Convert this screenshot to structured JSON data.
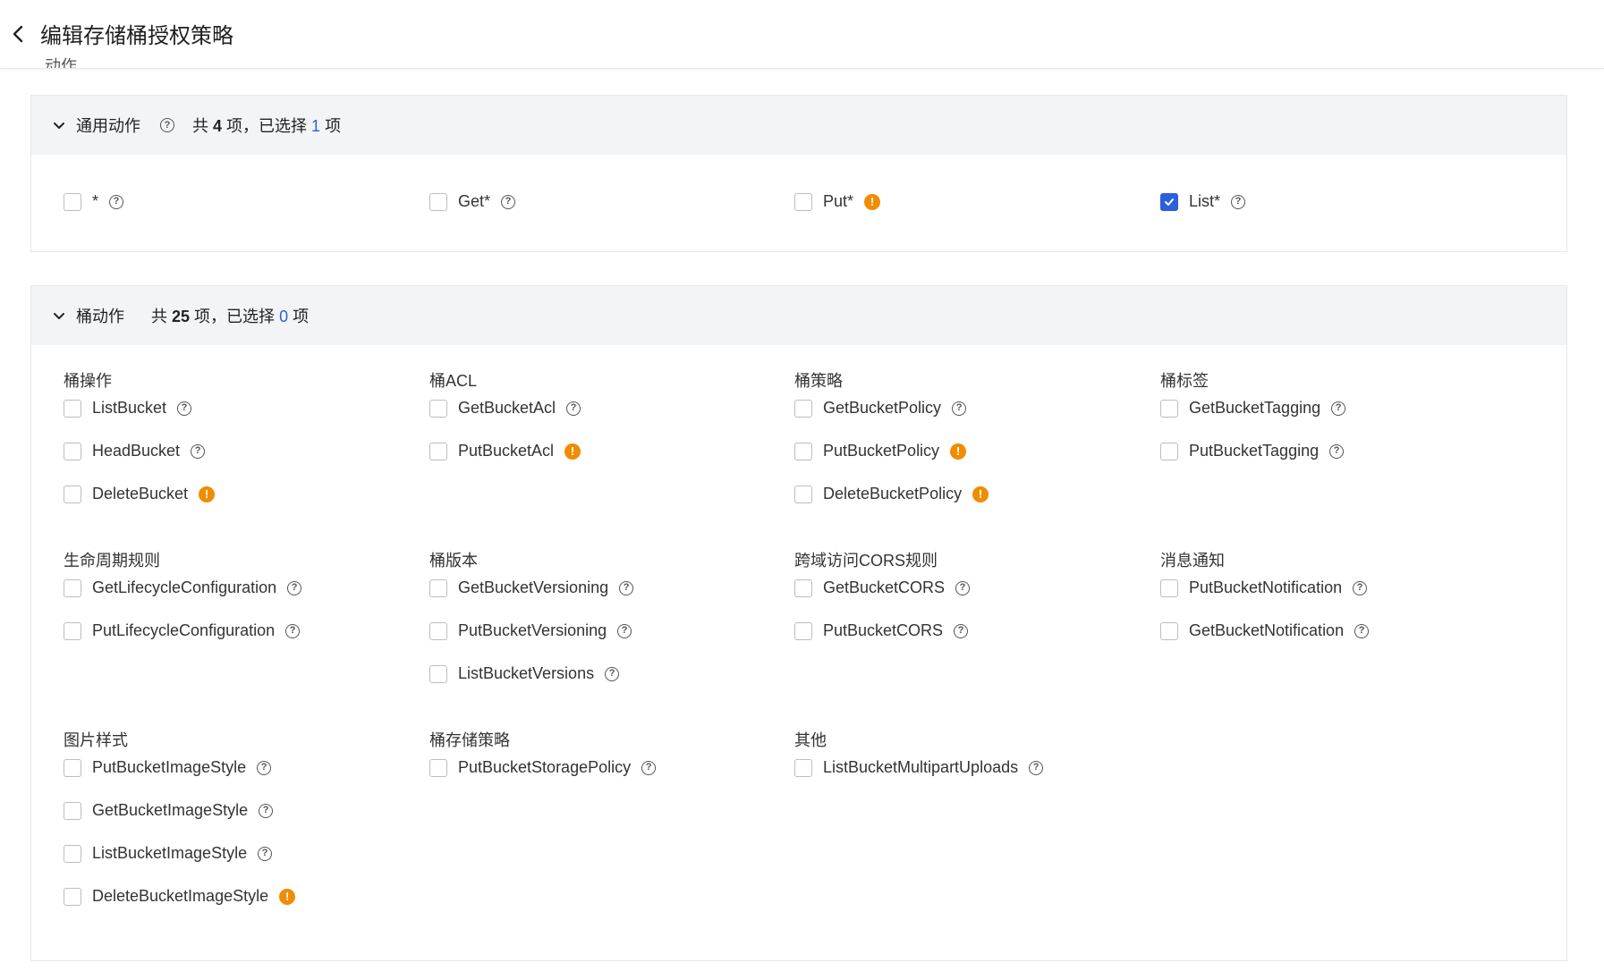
{
  "header": {
    "title": "编辑存储桶授权策略"
  },
  "peek_label": "动作",
  "general": {
    "name": "通用动作",
    "count_prefix": "共 ",
    "count_total": "4",
    "count_mid": " 项，已选择 ",
    "count_selected": "1",
    "count_suffix": " 项",
    "items": [
      {
        "label": "*",
        "checked": false,
        "icon": "help-icon"
      },
      {
        "label": "Get*",
        "checked": false,
        "icon": "help-icon"
      },
      {
        "label": "Put*",
        "checked": false,
        "icon": "warning-icon"
      },
      {
        "label": "List*",
        "checked": true,
        "icon": "help-icon"
      }
    ]
  },
  "bucket": {
    "name": "桶动作",
    "count_prefix": "共 ",
    "count_total": "25",
    "count_mid": " 项，已选择 ",
    "count_selected": "0",
    "count_suffix": " 项",
    "groups": [
      {
        "title": "桶操作",
        "items": [
          {
            "label": "ListBucket",
            "icon": "help-icon"
          },
          {
            "label": "HeadBucket",
            "icon": "help-icon"
          },
          {
            "label": "DeleteBucket",
            "icon": "warning-icon"
          }
        ]
      },
      {
        "title": "桶ACL",
        "items": [
          {
            "label": "GetBucketAcl",
            "icon": "help-icon"
          },
          {
            "label": "PutBucketAcl",
            "icon": "warning-icon"
          }
        ]
      },
      {
        "title": "桶策略",
        "items": [
          {
            "label": "GetBucketPolicy",
            "icon": "help-icon"
          },
          {
            "label": "PutBucketPolicy",
            "icon": "warning-icon"
          },
          {
            "label": "DeleteBucketPolicy",
            "icon": "warning-icon"
          }
        ]
      },
      {
        "title": "桶标签",
        "items": [
          {
            "label": "GetBucketTagging",
            "icon": "help-icon"
          },
          {
            "label": "PutBucketTagging",
            "icon": "help-icon"
          }
        ]
      },
      {
        "title": "生命周期规则",
        "items": [
          {
            "label": "GetLifecycleConfiguration",
            "icon": "help-icon"
          },
          {
            "label": "PutLifecycleConfiguration",
            "icon": "help-icon"
          }
        ]
      },
      {
        "title": "桶版本",
        "items": [
          {
            "label": "GetBucketVersioning",
            "icon": "help-icon"
          },
          {
            "label": "PutBucketVersioning",
            "icon": "help-icon"
          },
          {
            "label": "ListBucketVersions",
            "icon": "help-icon"
          }
        ]
      },
      {
        "title": "跨域访问CORS规则",
        "items": [
          {
            "label": "GetBucketCORS",
            "icon": "help-icon"
          },
          {
            "label": "PutBucketCORS",
            "icon": "help-icon"
          }
        ]
      },
      {
        "title": "消息通知",
        "items": [
          {
            "label": "PutBucketNotification",
            "icon": "help-icon"
          },
          {
            "label": "GetBucketNotification",
            "icon": "help-icon"
          }
        ]
      },
      {
        "title": "图片样式",
        "items": [
          {
            "label": "PutBucketImageStyle",
            "icon": "help-icon"
          },
          {
            "label": "GetBucketImageStyle",
            "icon": "help-icon"
          },
          {
            "label": "ListBucketImageStyle",
            "icon": "help-icon"
          },
          {
            "label": "DeleteBucketImageStyle",
            "icon": "warning-icon"
          }
        ]
      },
      {
        "title": "桶存储策略",
        "items": [
          {
            "label": "PutBucketStoragePolicy",
            "icon": "help-icon"
          }
        ]
      },
      {
        "title": "其他",
        "items": [
          {
            "label": "ListBucketMultipartUploads",
            "icon": "help-icon"
          }
        ]
      }
    ]
  },
  "colors": {
    "accent": "#2b5fe0",
    "warning": "#f08c00",
    "panel_header_bg": "#f3f4f6"
  }
}
